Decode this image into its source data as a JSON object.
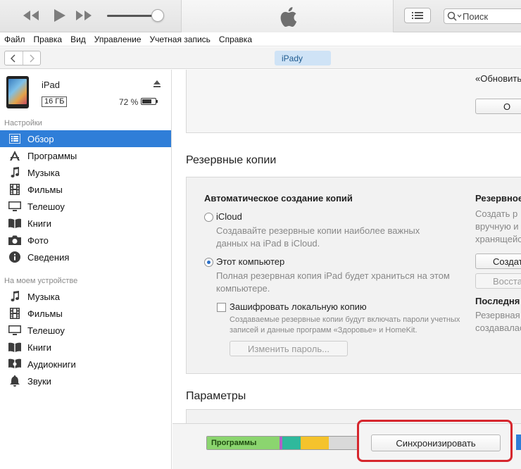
{
  "toolbar": {
    "search_placeholder": "Поиск"
  },
  "menu": [
    "Файл",
    "Правка",
    "Вид",
    "Управление",
    "Учетная запись",
    "Справка"
  ],
  "nav": {
    "device_pill": "iPady"
  },
  "device": {
    "name": "iPad",
    "capacity": "16 ГБ",
    "battery": "72 %"
  },
  "sidebar": {
    "settings_label": "Настройки",
    "settings_items": [
      {
        "label": "Обзор",
        "icon": "summary-icon",
        "active": true
      },
      {
        "label": "Программы",
        "icon": "apps-icon"
      },
      {
        "label": "Музыка",
        "icon": "music-icon"
      },
      {
        "label": "Фильмы",
        "icon": "film-icon"
      },
      {
        "label": "Телешоу",
        "icon": "tv-icon"
      },
      {
        "label": "Книги",
        "icon": "book-icon"
      },
      {
        "label": "Фото",
        "icon": "camera-icon"
      },
      {
        "label": "Сведения",
        "icon": "info-icon"
      }
    ],
    "device_label": "На моем устройстве",
    "device_items": [
      {
        "label": "Музыка",
        "icon": "music-icon"
      },
      {
        "label": "Фильмы",
        "icon": "film-icon"
      },
      {
        "label": "Телешоу",
        "icon": "tv-icon"
      },
      {
        "label": "Книги",
        "icon": "book-icon"
      },
      {
        "label": "Аудиокниги",
        "icon": "audiobook-icon"
      },
      {
        "label": "Звуки",
        "icon": "bell-icon"
      }
    ]
  },
  "main": {
    "top_text": "«Обновить",
    "top_button": "О",
    "backups_title": "Резервные копии",
    "auto_title": "Автоматическое создание копий",
    "icloud_label": "iCloud",
    "icloud_desc_1": "Создавайте резервные копии наиболее важных",
    "icloud_desc_2": "данных на iPad в iCloud.",
    "computer_label": "Этот компьютер",
    "computer_desc_1": "Полная резервная копия iPad будет храниться на этом",
    "computer_desc_2": "компьютере.",
    "encrypt_label": "Зашифровать локальную копию",
    "encrypt_desc_1": "Создаваемые резервные копии будут включать пароли учетных",
    "encrypt_desc_2": "записей и данные программ «Здоровье» и HomeKit.",
    "change_password": "Изменить пароль...",
    "right_title": "Резервное",
    "right_desc_1": "Создать р",
    "right_desc_2": "вручную и",
    "right_desc_3": "хранящейс",
    "create_btn": "Создат",
    "restore_btn": "Восстан",
    "last_title": "Последня",
    "last_desc_1": "Резервная",
    "last_desc_2": "создавалась",
    "params_title": "Параметры"
  },
  "footer": {
    "apps_segment": "Программы",
    "sync_button": "Синхронизировать"
  },
  "colors": {
    "accent": "#2f7ed8",
    "highlight": "#d6262d",
    "apps": "#8bd56f",
    "purple": "#b45fc8",
    "teal": "#2fb99c",
    "yellow": "#f5c32c",
    "free": "#d9d9d9"
  }
}
